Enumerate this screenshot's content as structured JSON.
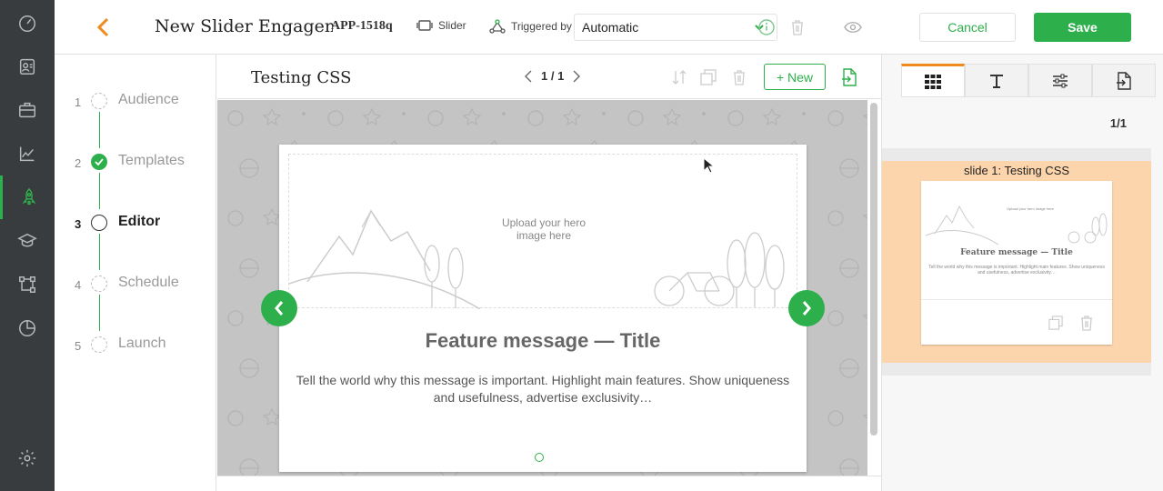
{
  "header": {
    "title": "New Slider Engagement",
    "app_id": "APP-1518q",
    "type_label": "Slider",
    "triggered_label": "Triggered by",
    "trigger_value": "Automatic",
    "cancel_label": "Cancel",
    "save_label": "Save"
  },
  "steps": [
    {
      "num": "1",
      "label": "Audience"
    },
    {
      "num": "2",
      "label": "Templates"
    },
    {
      "num": "3",
      "label": "Editor"
    },
    {
      "num": "4",
      "label": "Schedule"
    },
    {
      "num": "5",
      "label": "Launch"
    }
  ],
  "editor": {
    "title": "Testing CSS",
    "pager": "1 / 1",
    "new_label": "+ New"
  },
  "slide": {
    "hero_text_1": "Upload your hero",
    "hero_text_2": "image here",
    "title": "Feature message — Title",
    "body": "Tell the world why this message is important. Highlight main features. Show uniqueness and usefulness, advertise exclusivity…"
  },
  "panel": {
    "count": "1/1",
    "thumb_label": "slide 1: Testing CSS",
    "thumb_title": "Feature message — Title",
    "thumb_body": "Tell the world why this message is important. Highlight main features. Show uniqueness and usefulness, advertise exclusivity…",
    "thumb_hero_text": "Upload your hero image here"
  },
  "colors": {
    "accent_green": "#2db04b",
    "accent_orange": "#f08a1c",
    "rail": "#393c3f",
    "thumb_highlight": "#fdd5ac"
  },
  "icons": {
    "rail": [
      "dashboard-icon",
      "contacts-icon",
      "briefcase-icon",
      "analytics-icon",
      "rocket-icon",
      "learn-icon",
      "flows-icon",
      "reports-icon",
      "settings-icon"
    ],
    "tabs": [
      "grid-icon",
      "text-icon",
      "sliders-icon",
      "css-file-icon"
    ]
  }
}
